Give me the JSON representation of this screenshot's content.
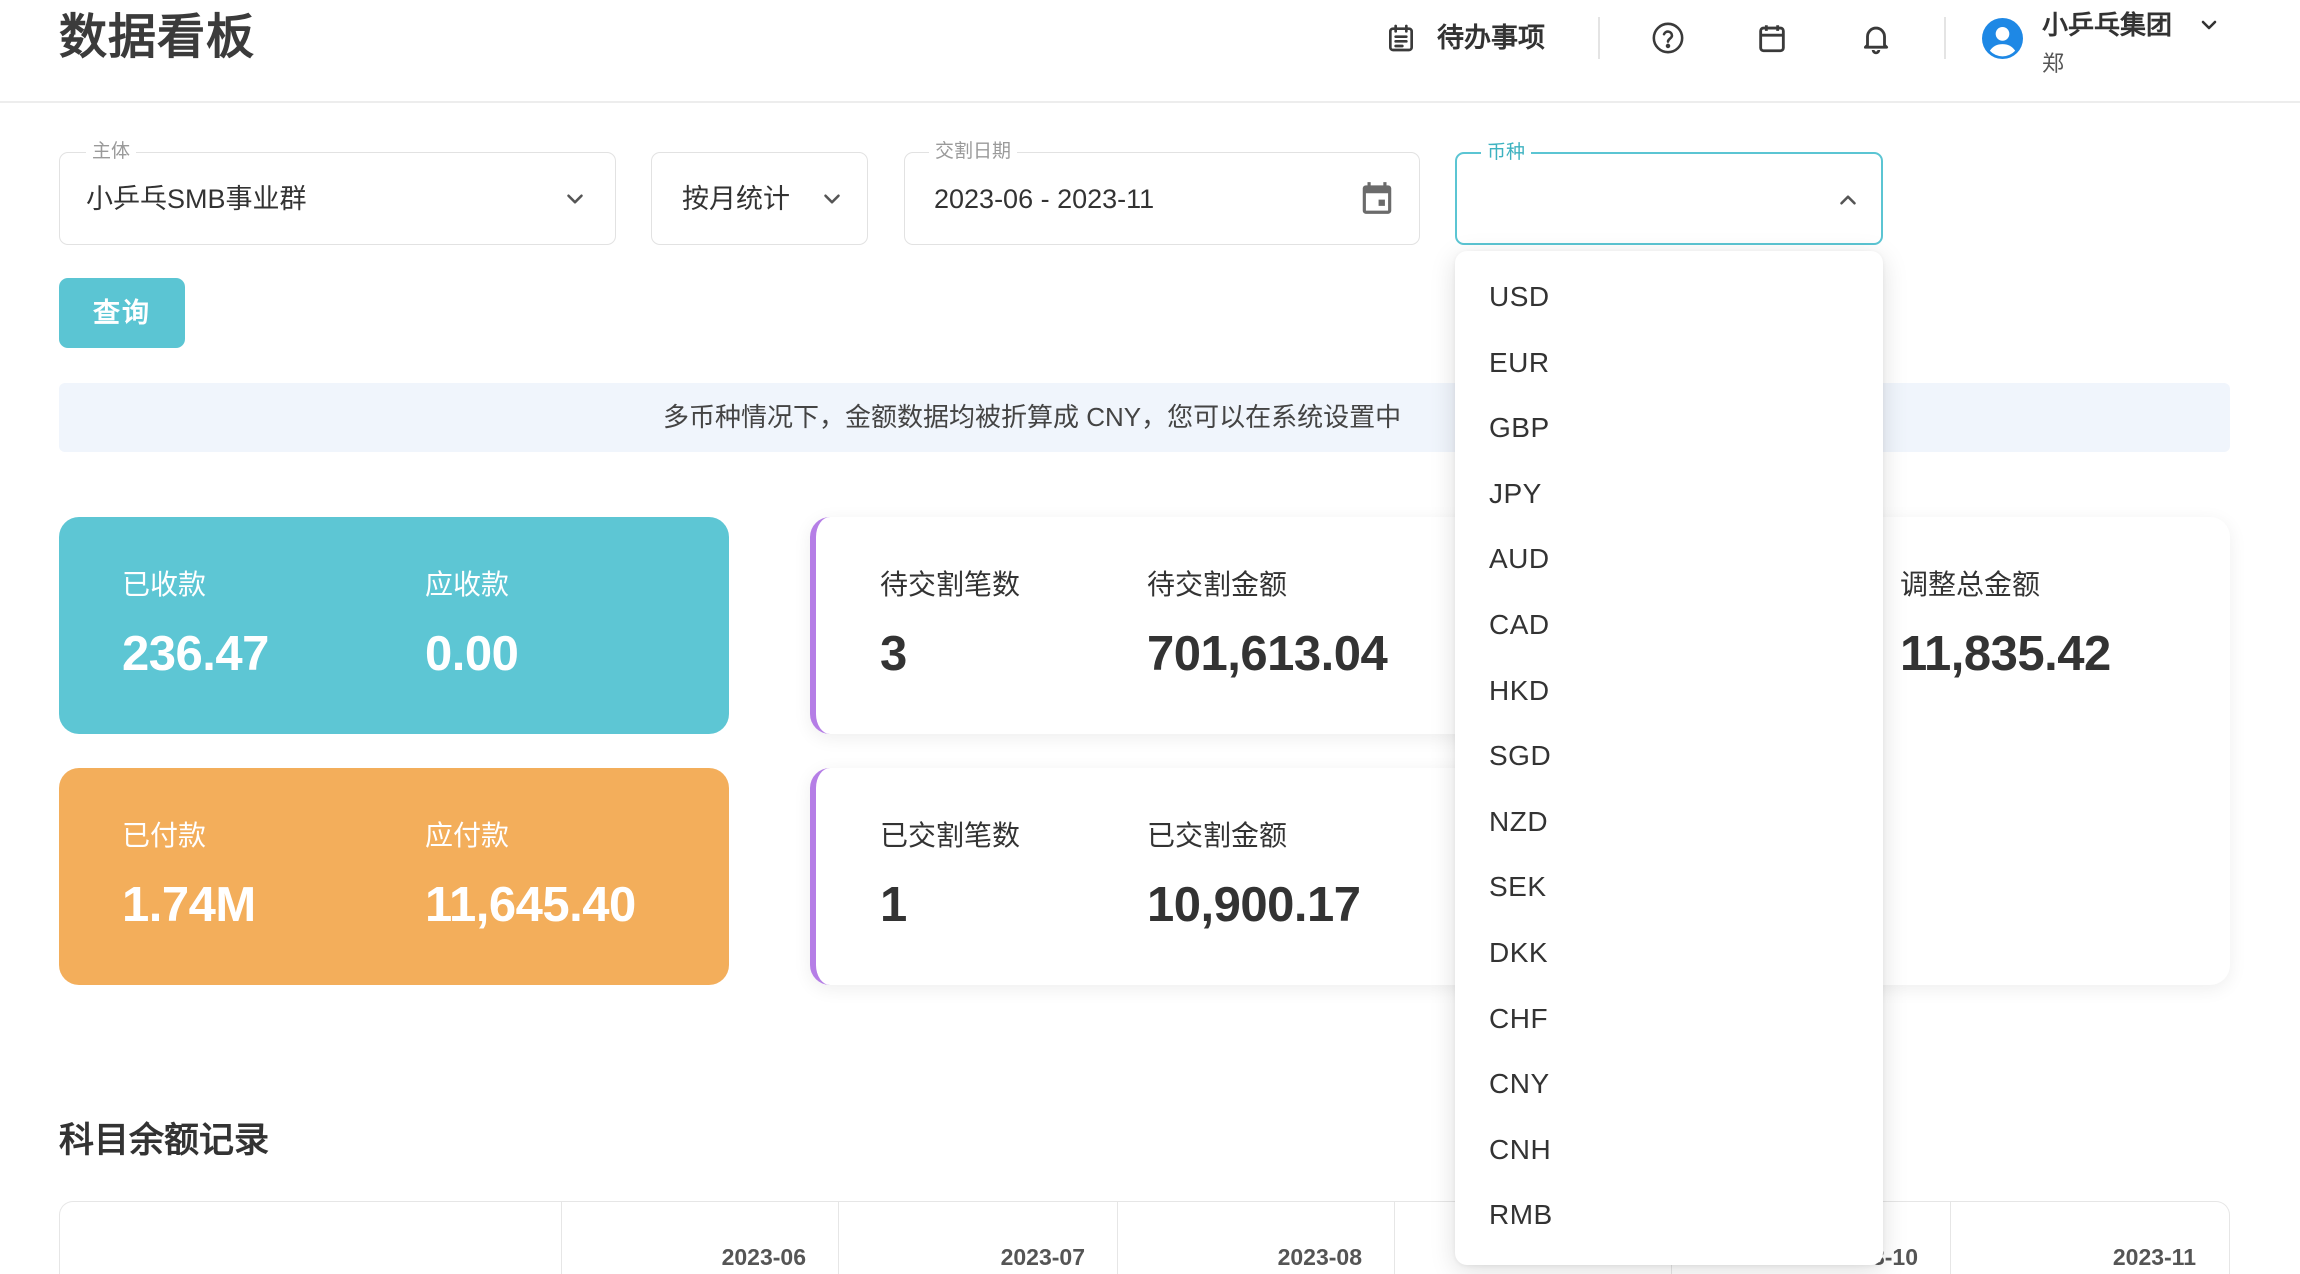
{
  "header": {
    "title": "数据看板",
    "todo_label": "待办事项",
    "company": "小乒乓集团",
    "user": "郑",
    "icons": [
      "todo-list-icon",
      "help-icon",
      "calendar-icon",
      "bell-icon",
      "avatar",
      "chevron-down-icon"
    ]
  },
  "filters": {
    "entity": {
      "label": "主体",
      "value": "小乒乓SMB事业群"
    },
    "granularity": {
      "value": "按月统计"
    },
    "settlement_date": {
      "label": "交割日期",
      "value": "2023-06 - 2023-11"
    },
    "currency": {
      "label": "币种",
      "expanded": true,
      "options": [
        "USD",
        "EUR",
        "GBP",
        "JPY",
        "AUD",
        "CAD",
        "HKD",
        "SGD",
        "NZD",
        "SEK",
        "DKK",
        "CHF",
        "CNY",
        "CNH",
        "RMB"
      ]
    }
  },
  "query_button": {
    "label": "查询"
  },
  "notice": {
    "text": "多币种情况下，金额数据均被折算成 CNY，您可以在系统设置中"
  },
  "summary": {
    "receipts": {
      "received_label": "已收款",
      "received_value": "236.47",
      "receivable_label": "应收款",
      "receivable_value": "0.00"
    },
    "payments": {
      "paid_label": "已付款",
      "paid_value": "1.74M",
      "payable_label": "应付款",
      "payable_value": "11,645.40"
    },
    "pending_settlement": {
      "count_label": "待交割笔数",
      "count_value": "3",
      "amount_label": "待交割金额",
      "amount_value": "701,613.04"
    },
    "settled": {
      "count_label": "已交割笔数",
      "count_value": "1",
      "amount_label": "已交割金额",
      "amount_value": "10,900.17"
    },
    "adjustment": {
      "total_label": "调整总金额",
      "total_value": "11,835.42"
    }
  },
  "balance_records": {
    "title": "科目余额记录",
    "periods": [
      "2023-06",
      "2023-07",
      "2023-08",
      "2023-10",
      "2023-11"
    ]
  },
  "colors": {
    "accent": "#5bc5d3",
    "receipts_card": "#5dc6d4",
    "payments_card": "#f3ae5b",
    "card_border": "#b57ee6",
    "notice_bg": "#f0f5fc",
    "avatar": "#1e88e5"
  }
}
